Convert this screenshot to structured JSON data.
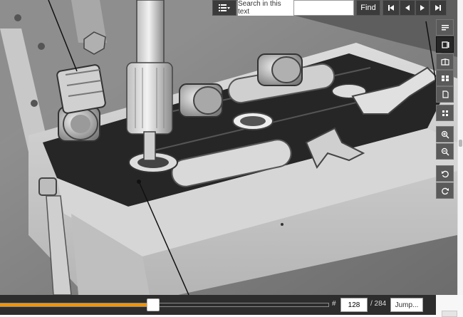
{
  "toolbar": {
    "menu_icon": "list-icon",
    "search_label": "Search in this text",
    "search_value": "",
    "find_label": "Find",
    "nav_icons": [
      "first-page-icon",
      "previous-page-icon",
      "next-page-icon",
      "last-page-icon"
    ]
  },
  "side_toolbar": {
    "items": [
      {
        "icon": "text-view-icon",
        "active": false
      },
      {
        "icon": "single-page-icon",
        "active": true
      },
      {
        "icon": "two-page-icon",
        "active": false
      },
      {
        "icon": "thumbnails-icon",
        "active": false
      },
      {
        "icon": "page-icon",
        "active": false
      },
      {
        "icon": "grid-icon",
        "active": false
      },
      {
        "icon": "zoom-in-icon",
        "active": false
      },
      {
        "icon": "zoom-out-icon",
        "active": false
      },
      {
        "icon": "rotate-left-icon",
        "active": false
      },
      {
        "icon": "rotate-right-icon",
        "active": false
      }
    ]
  },
  "pager": {
    "hash": "#",
    "current_page": "128",
    "total_text": "/ 284",
    "progress_fraction": 0.45,
    "jump_label": "Jump..."
  },
  "colors": {
    "progress": "#f29400",
    "toolbar": "#3b3b3b",
    "bottom_bar": "#2d2d2d"
  }
}
